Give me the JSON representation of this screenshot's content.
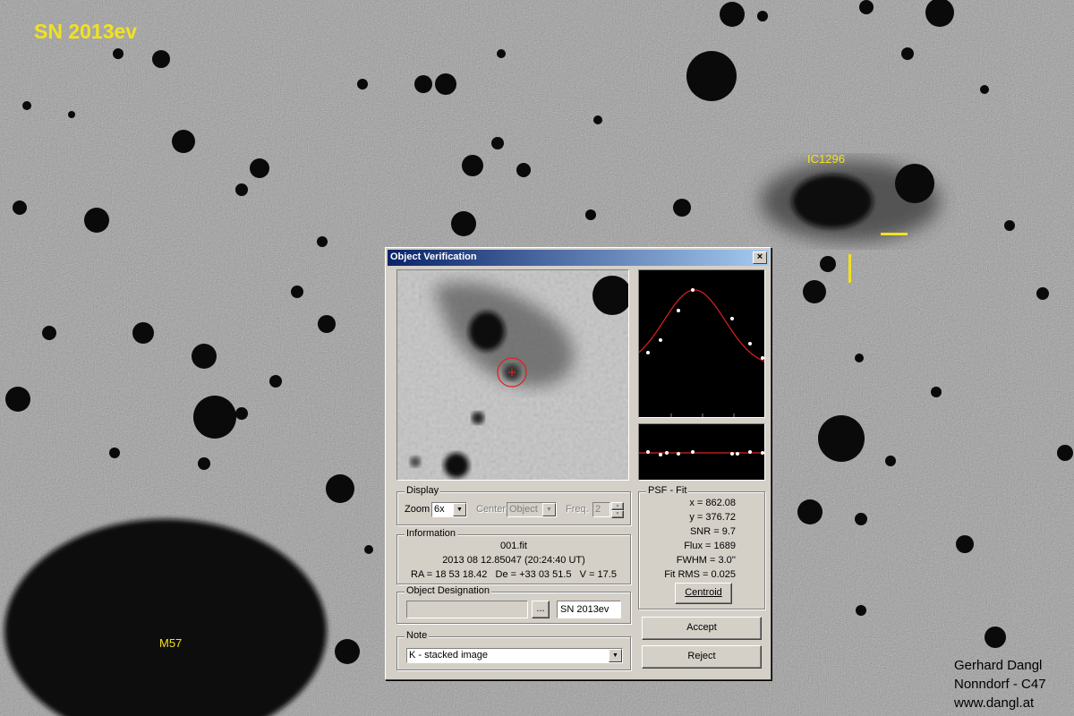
{
  "image": {
    "title": "SN 2013ev",
    "labels": {
      "galaxy": "IC1296",
      "nebula": "M57"
    },
    "credit": [
      "Gerhard Dangl",
      "Nonndorf - C47",
      "www.dangl.at"
    ],
    "marker_color": "#f2e21e"
  },
  "dialog": {
    "title": "Object Verification",
    "close_glyph": "×",
    "display": {
      "group_label": "Display",
      "zoom_label": "Zoom",
      "zoom_value": "6x",
      "center_label": "Center",
      "center_value": "Object",
      "freq_label": "Freq.",
      "freq_value": "2"
    },
    "information": {
      "group_label": "Information",
      "file": "001.fit",
      "datetime": "2013 08 12.85047 (20:24:40 UT)",
      "coords": "RA = 18 53 18.42   De = +33 03 51.5   V = 17.5"
    },
    "designation": {
      "group_label": "Object Designation",
      "input_value": "",
      "browse_label": "...",
      "name_value": "SN 2013ev"
    },
    "note": {
      "group_label": "Note",
      "value": "K - stacked image"
    },
    "psf": {
      "group_label": "PSF - Fit",
      "lines": [
        "x = 862.08",
        "y = 376.72",
        "SNR = 9.7",
        "Flux = 1689",
        "FWHM = 3.0''",
        "Fit RMS = 0.025"
      ],
      "centroid_label": "Centroid"
    },
    "accept_label": "Accept",
    "reject_label": "Reject"
  }
}
